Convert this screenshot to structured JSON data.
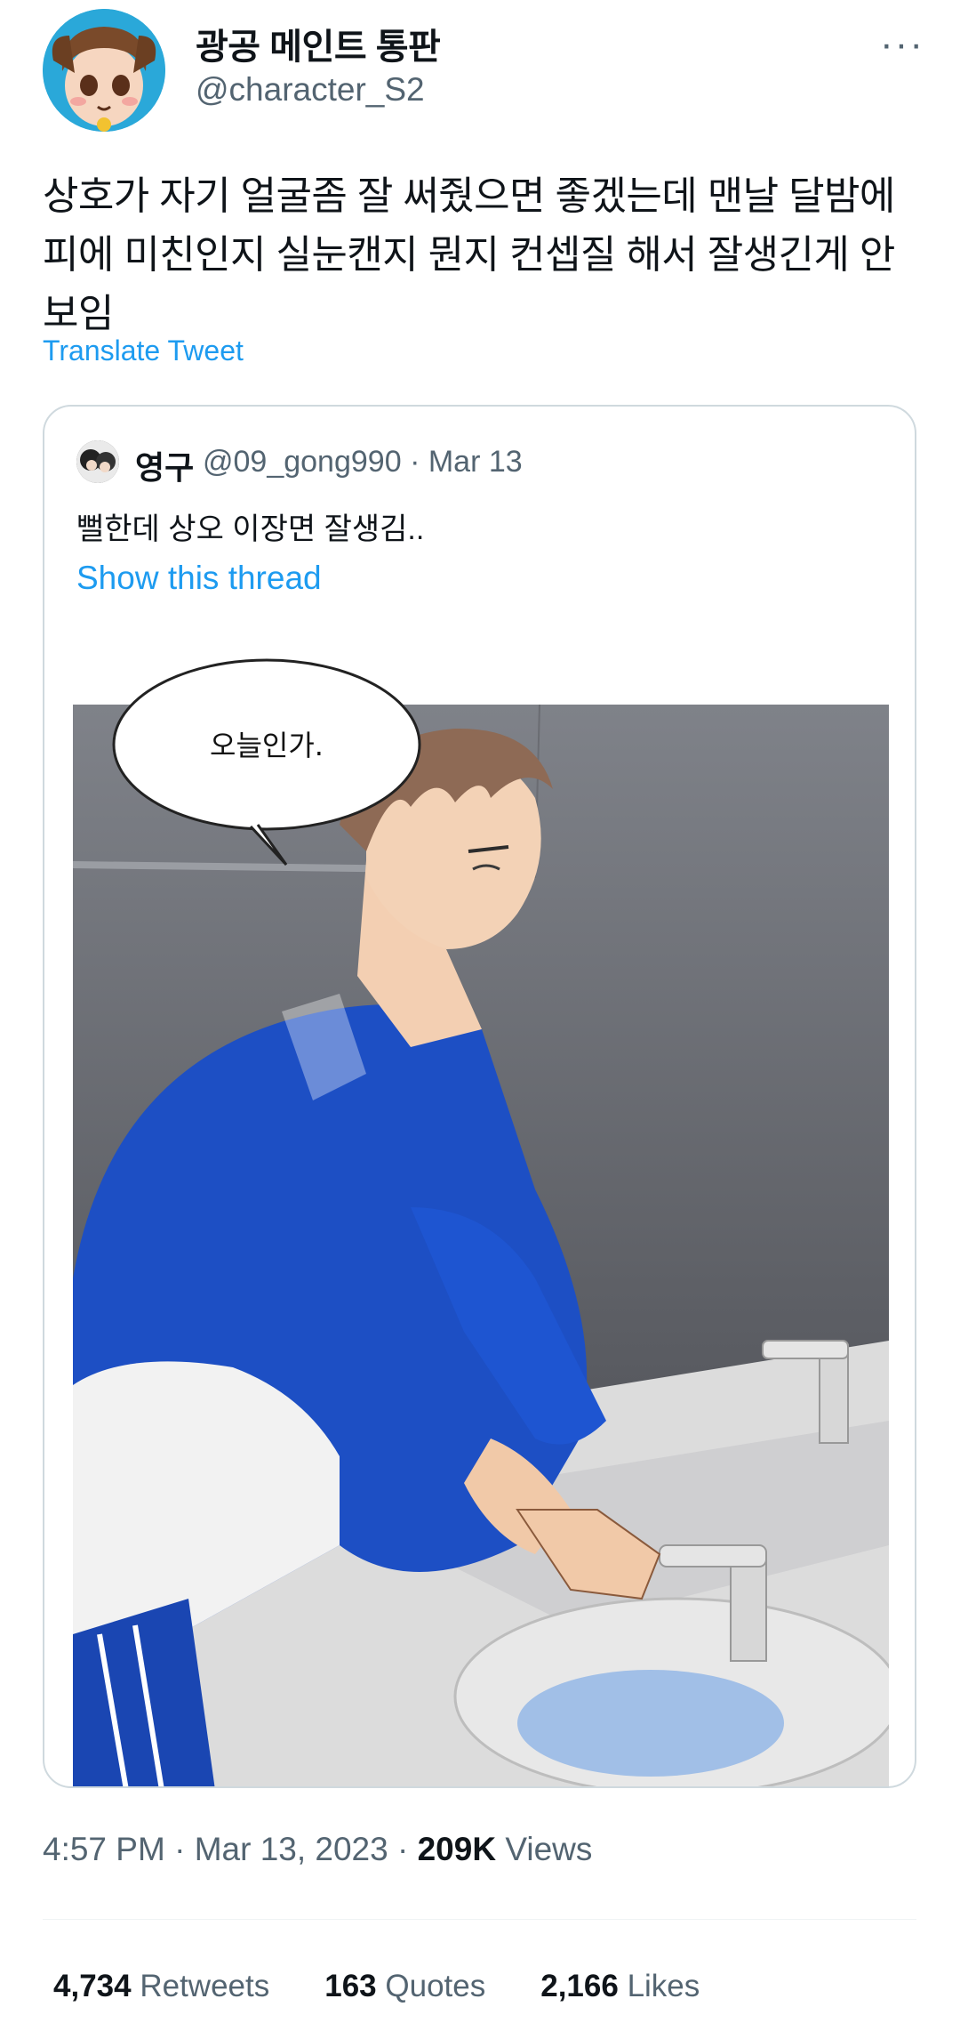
{
  "author": {
    "name": "광공 메인트 통판",
    "handle": "@character_S2"
  },
  "more_label": "···",
  "tweet_text": "상호가 자기 얼굴좀 잘 써줬으면 좋겠는데 맨날 달밤에 피에 미친인지 실눈캔지 뭔지 컨셉질 해서 잘생긴게 안보임",
  "translate_label": "Translate Tweet",
  "quote": {
    "name": "영구",
    "handle": "@09_gong990",
    "sep": "·",
    "date": "Mar 13",
    "text": "뻘한데 상오 이장면 잘생김..",
    "show_thread": "Show this thread",
    "image_speech": "오늘인가."
  },
  "meta": {
    "time": "4:57 PM",
    "sep": "·",
    "date": "Mar 13, 2023",
    "views_count": "209K",
    "views_label": "Views"
  },
  "stats": [
    {
      "count": "4,734",
      "label": "Retweets"
    },
    {
      "count": "163",
      "label": "Quotes"
    },
    {
      "count": "2,166",
      "label": "Likes"
    }
  ]
}
